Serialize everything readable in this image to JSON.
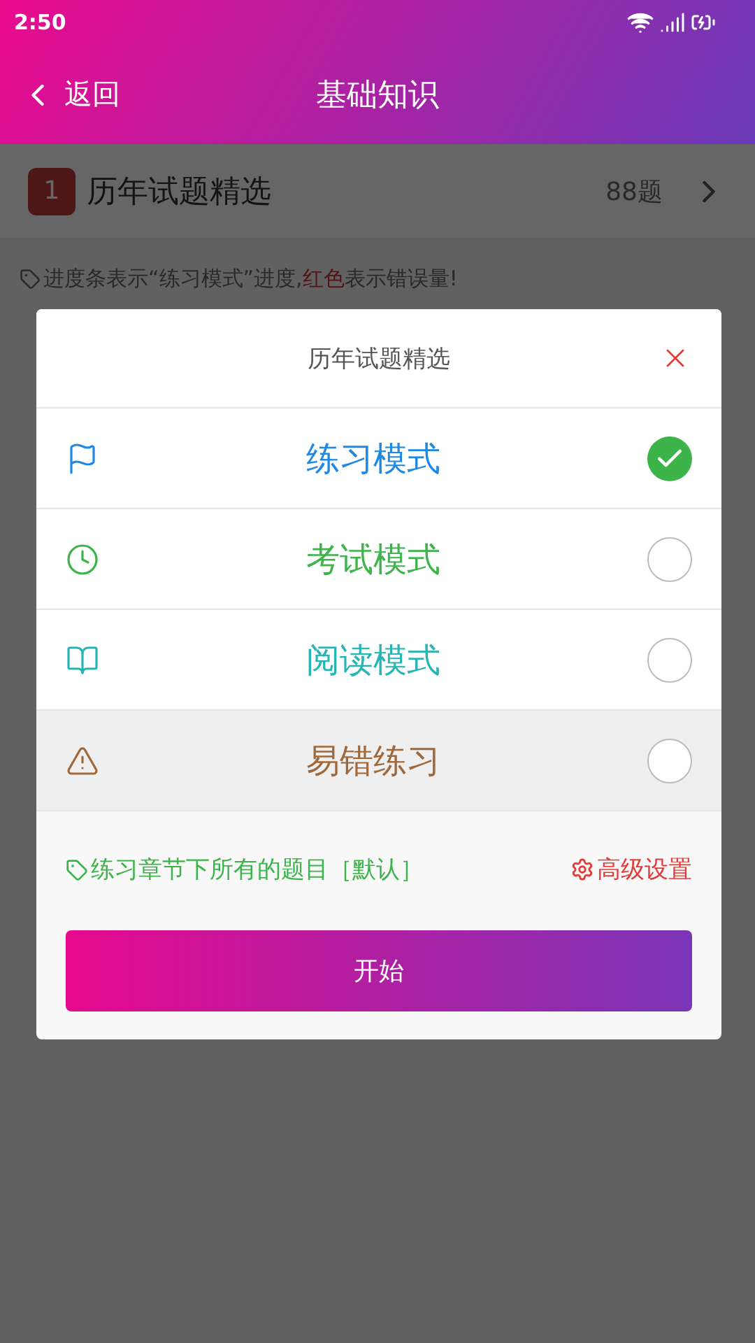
{
  "status_bar": {
    "time": "2:50"
  },
  "header": {
    "back": "返回",
    "title": "基础知识"
  },
  "chapter": {
    "number": "1",
    "title": "历年试题精选",
    "count": "88题"
  },
  "hint": [
    {
      "kind": "normal",
      "text": "进度条表示“练习模式”进度,"
    },
    {
      "kind": "red",
      "text": "红色"
    },
    {
      "kind": "normal",
      "text": "表示错误量!"
    }
  ],
  "dialog": {
    "title": "历年试题精选",
    "modes": [
      {
        "kind": "flag",
        "label": "练习模式",
        "color": "#1e88e5",
        "selected": true,
        "highlighted": false
      },
      {
        "kind": "clock",
        "label": "考试模式",
        "color": "#3cb44a",
        "selected": false,
        "highlighted": false
      },
      {
        "kind": "book",
        "label": "阅读模式",
        "color": "#26b5b5",
        "selected": false,
        "highlighted": false
      },
      {
        "kind": "warning",
        "label": "易错练习",
        "color": "#a0693c",
        "selected": false,
        "highlighted": true
      }
    ],
    "scope": "练习章节下所有的题目［默认］",
    "settings": "高级设置",
    "start": "开始"
  }
}
